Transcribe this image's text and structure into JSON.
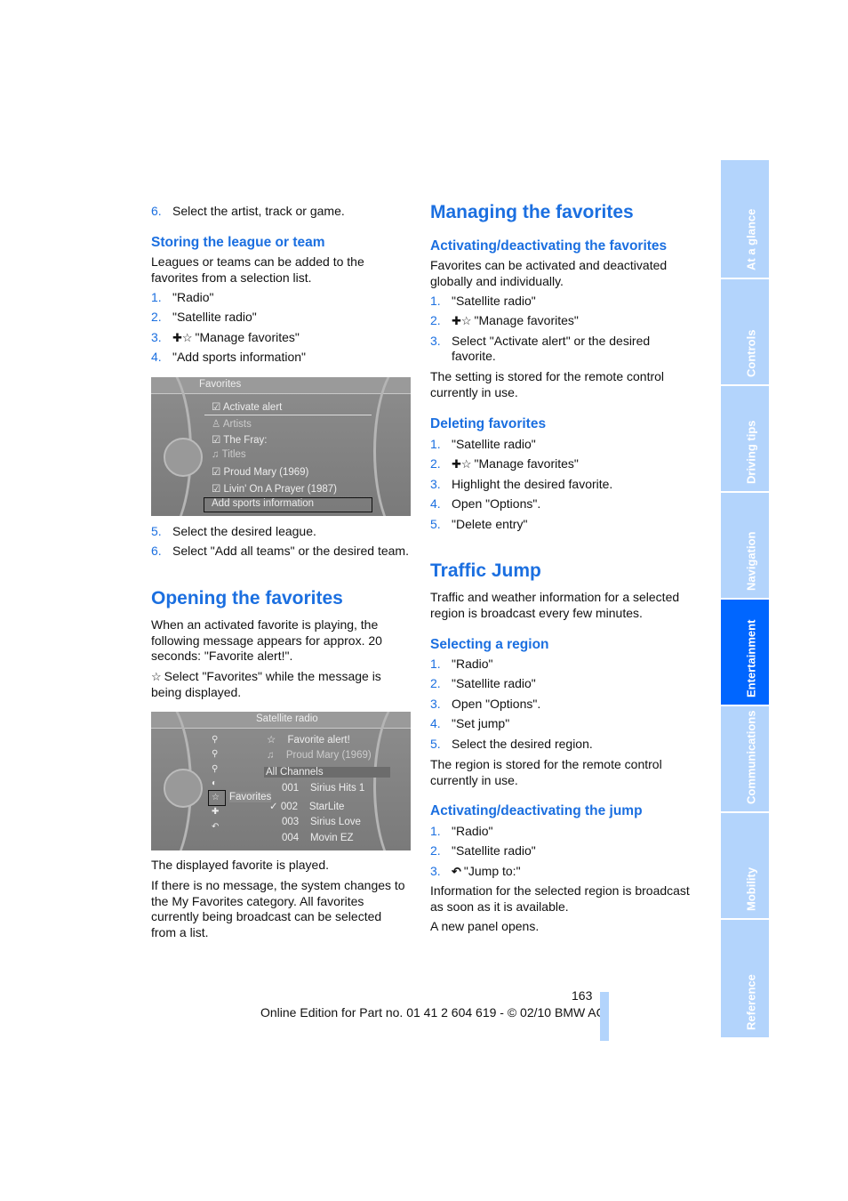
{
  "left": {
    "step6": {
      "n": "6.",
      "text": "Select the artist, track or game."
    },
    "storing": {
      "heading": "Storing the league or team",
      "intro": "Leagues or teams can be added to the favorites from a selection list.",
      "steps": [
        {
          "n": "1.",
          "text": "\"Radio\""
        },
        {
          "n": "2.",
          "text": "\"Satellite radio\""
        },
        {
          "n": "3.",
          "text": "\"Manage favorites\"",
          "icon": "manage-favorites-icon"
        },
        {
          "n": "4.",
          "text": "\"Add sports information\""
        }
      ],
      "steps2": [
        {
          "n": "5.",
          "text": "Select the desired league."
        },
        {
          "n": "6.",
          "text": "Select \"Add all teams\" or the desired team."
        }
      ]
    },
    "screen1": {
      "title": "Favorites",
      "rows": [
        "Activate alert",
        "Artists",
        "The Fray:",
        "Titles",
        "Proud Mary (1969)",
        "Livin' On A Prayer (1987)",
        "Add sports information"
      ]
    },
    "opening": {
      "heading": "Opening the favorites",
      "p1": "When an activated favorite is playing, the following message appears for approx. 20 seconds: \"Favorite alert!\".",
      "p2": "Select \"Favorites\" while the message is being displayed.",
      "p3": "The displayed favorite is played.",
      "p4": "If there is no message, the system changes to the My Favorites category. All favorites currently being broadcast can be selected from a list."
    },
    "screen2": {
      "title": "Satellite radio",
      "alert": "Favorite alert!",
      "song": "Proud Mary (1969)",
      "category": "All Channels",
      "menu_label": "Favorites",
      "channels": [
        {
          "num": "001",
          "name": "Sirius Hits 1"
        },
        {
          "num": "002",
          "name": "StarLite"
        },
        {
          "num": "003",
          "name": "Sirius Love"
        },
        {
          "num": "004",
          "name": "Movin EZ"
        }
      ]
    }
  },
  "right": {
    "managing": {
      "heading": "Managing the favorites"
    },
    "activating": {
      "heading": "Activating/deactivating the favorites",
      "intro": "Favorites can be activated and deactivated globally and individually.",
      "steps": [
        {
          "n": "1.",
          "text": "\"Satellite radio\""
        },
        {
          "n": "2.",
          "text": "\"Manage favorites\"",
          "icon": "manage-favorites-icon"
        },
        {
          "n": "3.",
          "text": "Select \"Activate alert\" or the desired favorite."
        }
      ],
      "note": "The setting is stored for the remote control currently in use."
    },
    "deleting": {
      "heading": "Deleting favorites",
      "steps": [
        {
          "n": "1.",
          "text": "\"Satellite radio\""
        },
        {
          "n": "2.",
          "text": "\"Manage favorites\"",
          "icon": "manage-favorites-icon"
        },
        {
          "n": "3.",
          "text": "Highlight the desired favorite."
        },
        {
          "n": "4.",
          "text": "Open \"Options\"."
        },
        {
          "n": "5.",
          "text": "\"Delete entry\""
        }
      ]
    },
    "traffic": {
      "heading": "Traffic Jump",
      "intro": "Traffic and weather information for a selected region is broadcast every few minutes."
    },
    "region": {
      "heading": "Selecting a region",
      "steps": [
        {
          "n": "1.",
          "text": "\"Radio\""
        },
        {
          "n": "2.",
          "text": "\"Satellite radio\""
        },
        {
          "n": "3.",
          "text": "Open \"Options\"."
        },
        {
          "n": "4.",
          "text": "\"Set jump\""
        },
        {
          "n": "5.",
          "text": "Select the desired region."
        }
      ],
      "note": "The region is stored for the remote control currently in use."
    },
    "jump": {
      "heading": "Activating/deactivating the jump",
      "steps": [
        {
          "n": "1.",
          "text": "\"Radio\""
        },
        {
          "n": "2.",
          "text": "\"Satellite radio\""
        },
        {
          "n": "3.",
          "text": "\"Jump to:\"",
          "icon": "jump-icon"
        }
      ],
      "p1": "Information for the selected region is broadcast as soon as it is available.",
      "p2": "A new panel opens."
    }
  },
  "sidebar": {
    "tabs": [
      "At a glance",
      "Controls",
      "Driving tips",
      "Navigation",
      "Entertainment",
      "Communications",
      "Mobility",
      "Reference"
    ],
    "active": "Entertainment",
    "colors": {
      "tab": "#b3d4fc",
      "active": "#0066ff"
    }
  },
  "footer": {
    "page": "163",
    "edition": "Online Edition for Part no. 01 41 2 604 619 - © 02/10 BMW AG"
  },
  "colors": {
    "heading": "#1b6fe0"
  }
}
